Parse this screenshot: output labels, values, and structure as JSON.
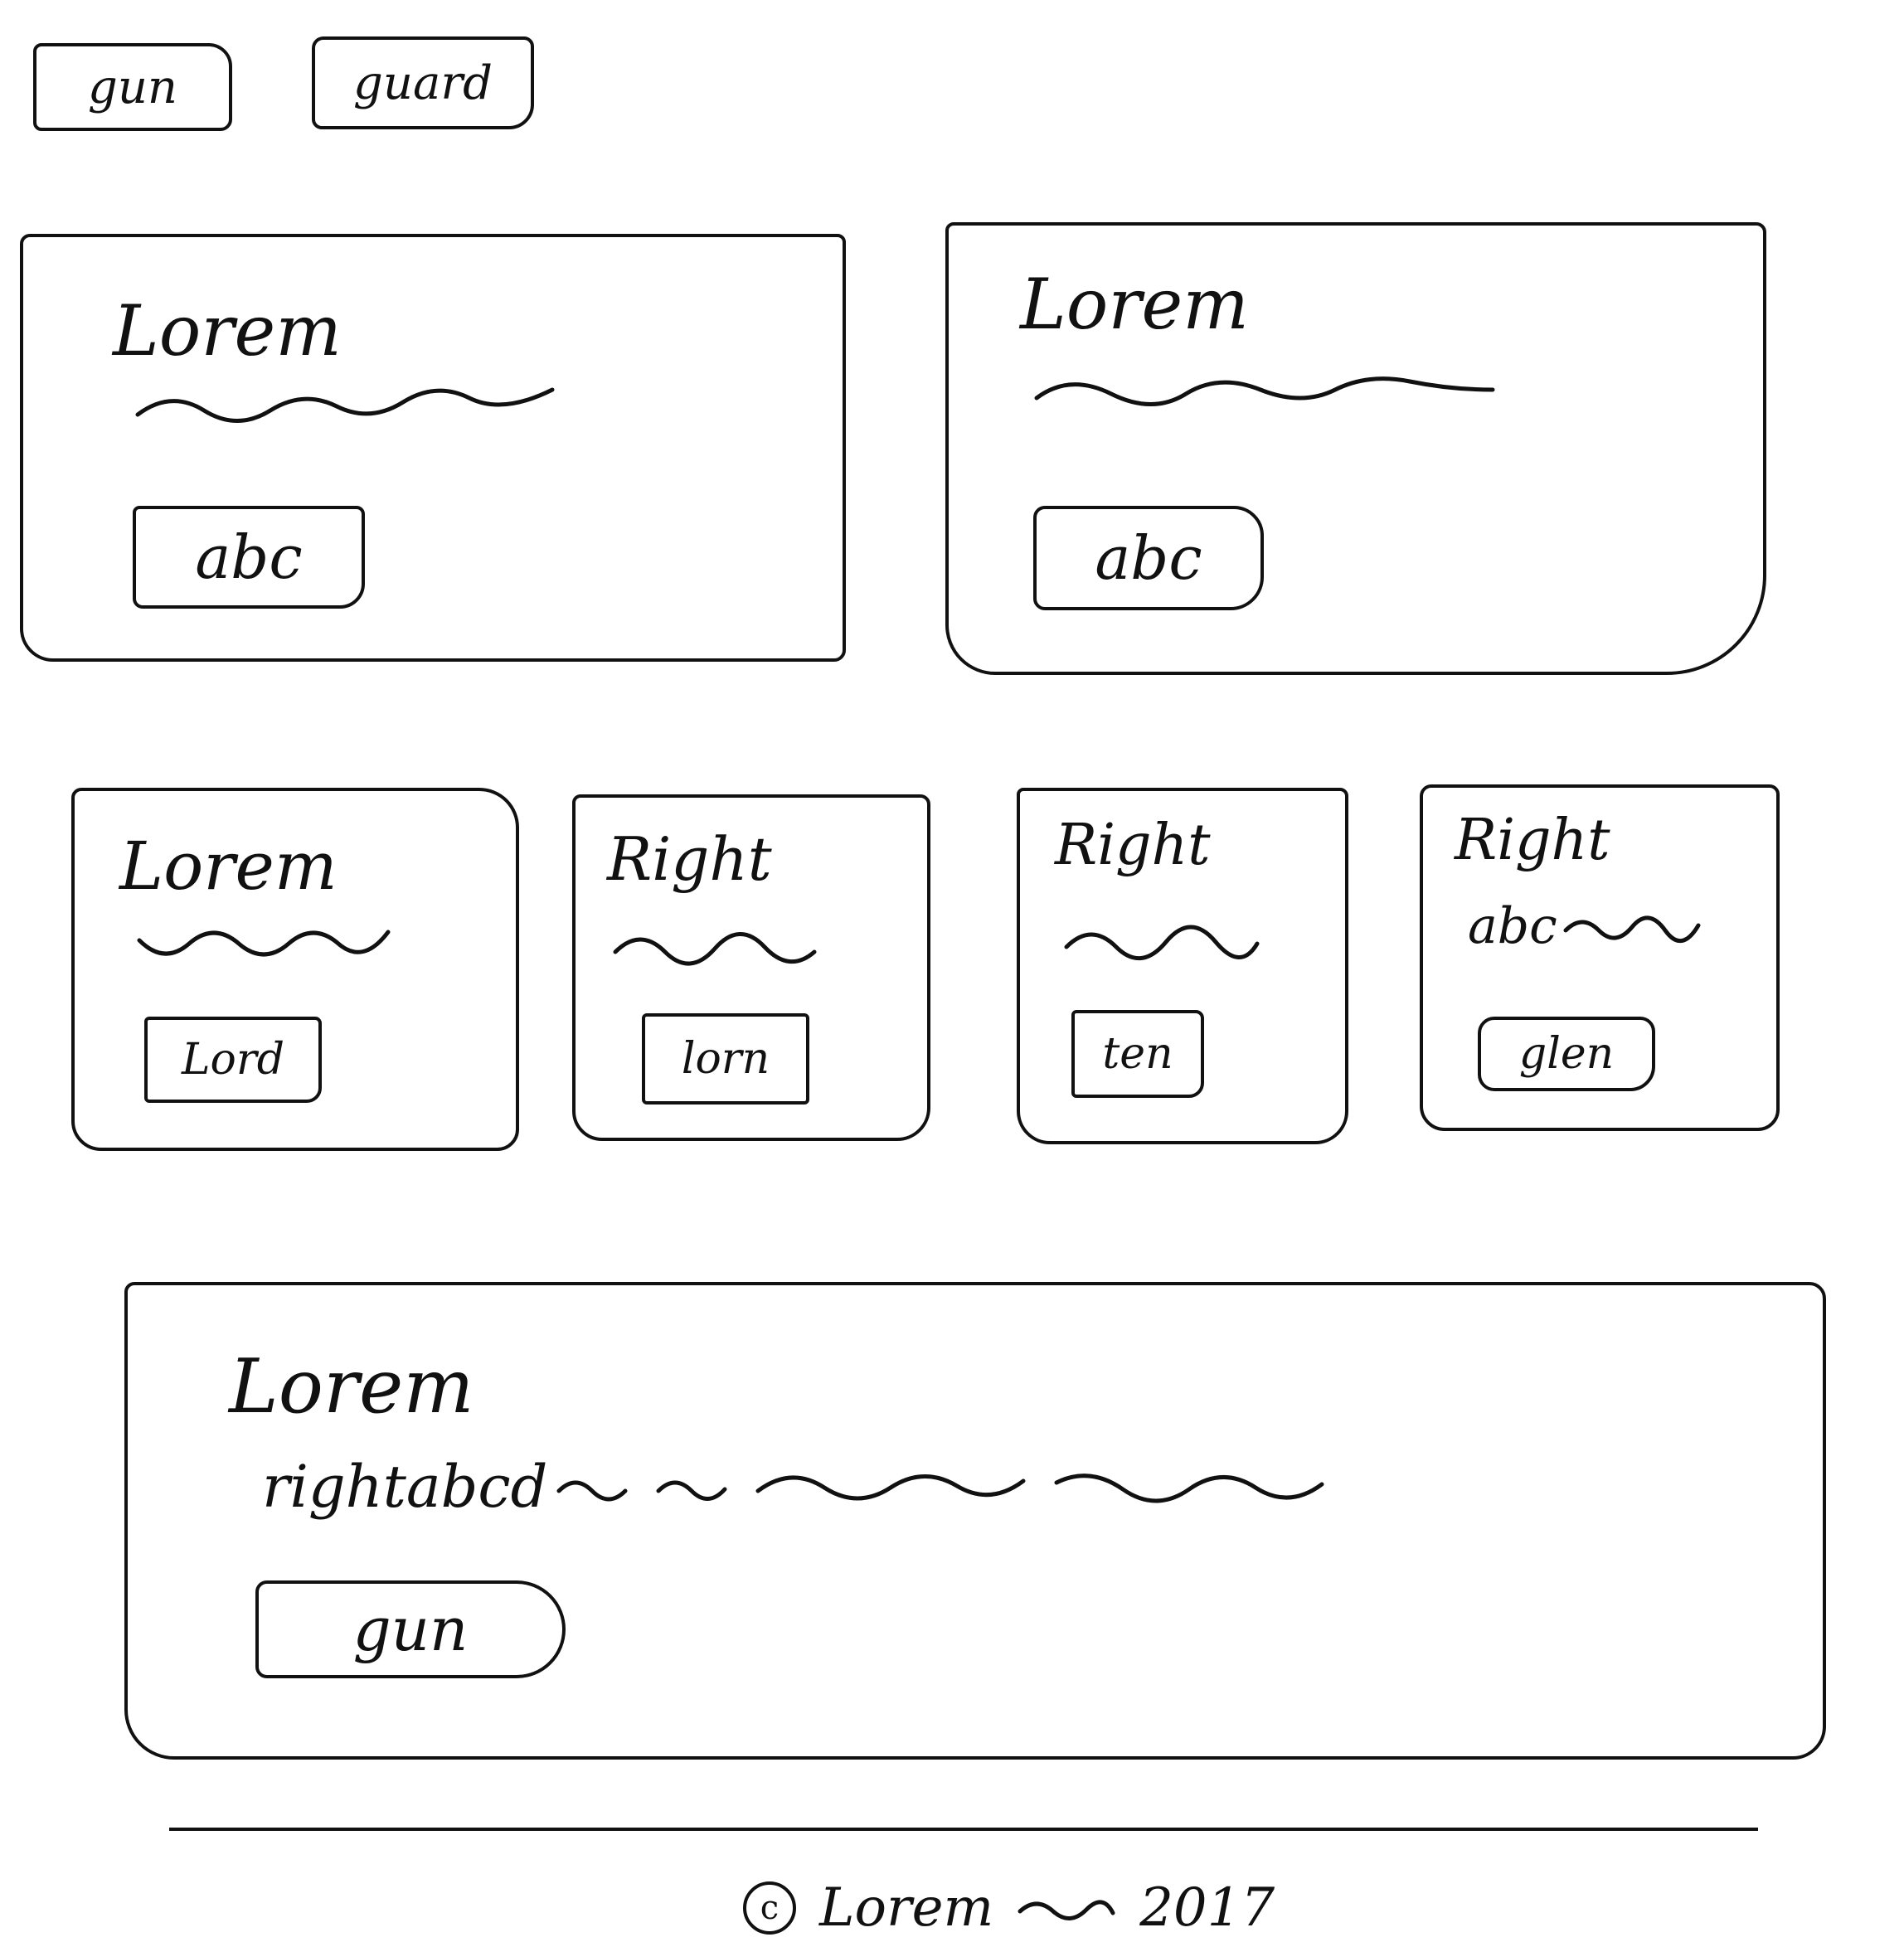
{
  "nav": {
    "buttons": [
      {
        "label": "gun"
      },
      {
        "label": "guard"
      }
    ]
  },
  "hero_cards": [
    {
      "title": "Lorem",
      "button": "abc"
    },
    {
      "title": "Lorem",
      "button": "abc"
    }
  ],
  "small_cards": [
    {
      "title": "Lorem",
      "button": "Lord"
    },
    {
      "title": "Right",
      "button": "lorn"
    },
    {
      "title": "Right",
      "button": "ten"
    },
    {
      "title": "Right",
      "subtitle": "abc",
      "button": "glen"
    }
  ],
  "wide_card": {
    "title": "Lorem",
    "text_prefix": "rightabcd",
    "button": "gun"
  },
  "footer": {
    "copyright_symbol": "c",
    "brand": "Lorem",
    "year": "2017"
  }
}
